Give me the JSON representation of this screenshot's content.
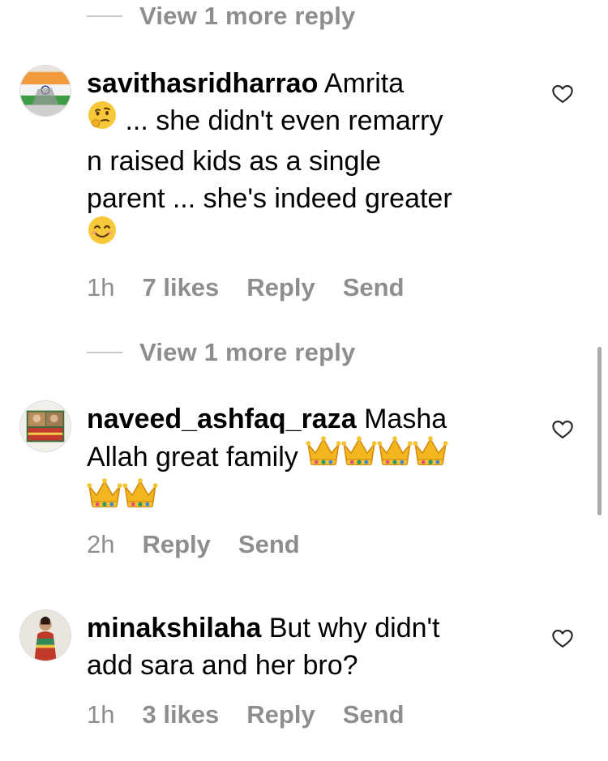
{
  "top_view_more": {
    "label": "View 1 more reply"
  },
  "comments": [
    {
      "username": "savithasridharrao",
      "line1_rest": " Amrita",
      "line2": " ... she didn't even remarry",
      "line3": "n raised kids as a single",
      "line4": "parent ... she's indeed greater",
      "emojis": [
        "thinking-face",
        "smiling-face"
      ],
      "time": "1h",
      "likes": "7 likes",
      "reply_label": "Reply",
      "send_label": "Send"
    },
    {
      "username": "naveed_ashfaq_raza",
      "line1_rest": " Masha",
      "line2": "Allah great family",
      "emojis": [
        "crown",
        "crown",
        "crown",
        "crown",
        "crown",
        "crown"
      ],
      "time": "2h",
      "reply_label": "Reply",
      "send_label": "Send"
    },
    {
      "username": "minakshilaha",
      "line1_rest": " But why didn't",
      "line2": "add sara and her bro?",
      "time": "1h",
      "likes": "3 likes",
      "reply_label": "Reply",
      "send_label": "Send"
    }
  ],
  "mid_view_more": {
    "label": "View 1 more reply"
  },
  "colors": {
    "text": "#000000",
    "secondary": "#8e8e8e",
    "divider": "#c7c7c7"
  },
  "icons": [
    "heart-outline-icon"
  ]
}
